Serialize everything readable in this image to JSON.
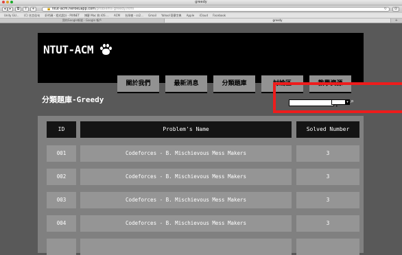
{
  "browser": {
    "window_title": "greedy",
    "url_host": "ntut-acm.herokuapp.com",
    "url_path": "/problems-greedy.html",
    "url_lock": "https:",
    "bookmarks": [
      "Unity GU...",
      "(C) 名言佳句",
      "好代碼 - 程式設計 - PIXNET",
      "博客 Mac 和 iOS ...",
      "ACM",
      "台灣夜 - cs2...",
      "Gmail",
      "Yahoo!奇摩字典",
      "Apple",
      "iCloud",
      "Facebook"
    ],
    "tabs": [
      {
        "label": "我的Google帳號 - Google 帳戶",
        "active": false
      },
      {
        "label": "greedy",
        "active": true
      }
    ]
  },
  "site": {
    "logo": "NTUT-ACM",
    "nav": [
      "關於我們",
      "最新消息",
      "分類題庫",
      "討論區",
      "教學資源"
    ]
  },
  "section": {
    "title": "分類題庫-Greedy"
  },
  "search": {
    "placeholder": "",
    "select_value": "",
    "button_icon": "search-icon"
  },
  "colors": {
    "page_bg": "#595959",
    "header_bg": "#000000",
    "nav_bg": "#929292",
    "table_bg": "#808080",
    "th_bg": "#141414",
    "td_bg": "#959595",
    "highlight": "#ee1c1c"
  },
  "table": {
    "headers": [
      "ID",
      "Problem's Name",
      "Solved Number"
    ],
    "rows": [
      {
        "id": "001",
        "name": "Codeforces - B. Mischievous Mess Makers",
        "solved": "3"
      },
      {
        "id": "002",
        "name": "Codeforces - B. Mischievous Mess Makers",
        "solved": "3"
      },
      {
        "id": "003",
        "name": "Codeforces - B. Mischievous Mess Makers",
        "solved": "3"
      },
      {
        "id": "004",
        "name": "Codeforces - B. Mischievous Mess Makers",
        "solved": "3"
      },
      {
        "id": "",
        "name": "",
        "solved": ""
      }
    ]
  }
}
